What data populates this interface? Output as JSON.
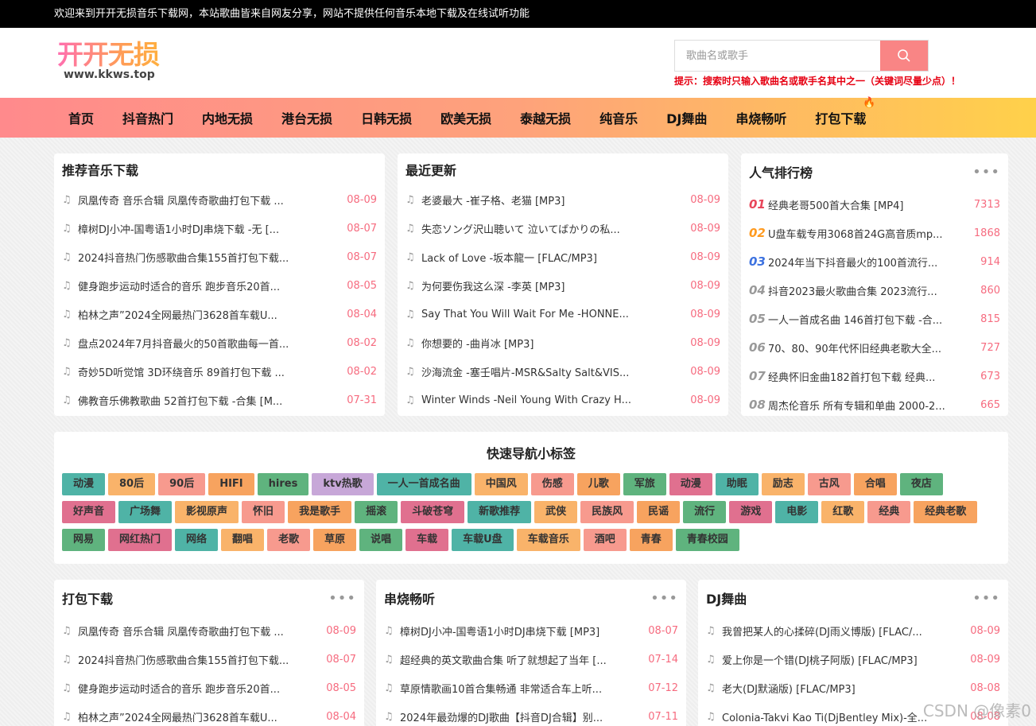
{
  "topbar": {
    "text": "欢迎来到开开无损音乐下载网，本站歌曲皆来自网友分享，网站不提供任何音乐本地下载及在线试听功能"
  },
  "logo": {
    "cn": "开开无损",
    "url": "www.kkws.top"
  },
  "search": {
    "placeholder": "歌曲名或歌手",
    "tip": "提示：搜索时只输入歌曲名或歌手名其中之一（关键词尽量少点）！"
  },
  "nav": [
    {
      "label": "首页"
    },
    {
      "label": "抖音热门"
    },
    {
      "label": "内地无损"
    },
    {
      "label": "港台无损"
    },
    {
      "label": "日韩无损"
    },
    {
      "label": "欧美无损"
    },
    {
      "label": "泰越无损"
    },
    {
      "label": "纯音乐"
    },
    {
      "label": "DJ舞曲"
    },
    {
      "label": "串烧畅听"
    },
    {
      "label": "打包下载"
    }
  ],
  "recommend": {
    "title": "推荐音乐下载",
    "items": [
      {
        "text": "凤凰传奇 音乐合辑 凤凰传奇歌曲打包下载 ...",
        "date": "08-09"
      },
      {
        "text": "樟树DJ小冲-国粤语1小时DJ串烧下载 -无 [...",
        "date": "08-07"
      },
      {
        "text": "2024抖音热门伤感歌曲合集155首打包下载...",
        "date": "08-07"
      },
      {
        "text": "健身跑步运动时适合的音乐 跑步音乐20首...",
        "date": "08-05"
      },
      {
        "text": "柏林之声”2024全网最热门3628首车载U...",
        "date": "08-04"
      },
      {
        "text": "盘点2024年7月抖音最火的50首歌曲每一首...",
        "date": "08-02"
      },
      {
        "text": "奇妙5D听觉馆 3D环绕音乐 89首打包下载 ...",
        "date": "08-02"
      },
      {
        "text": "佛教音乐佛教歌曲 52首打包下载 -合集 [M...",
        "date": "07-31"
      }
    ]
  },
  "latest": {
    "title": "最近更新",
    "items": [
      {
        "text": "老婆最大 -崔子格、老猫 [MP3]",
        "date": "08-09"
      },
      {
        "text": "失恋ソング沢山聴いて 泣いてばかりの私...",
        "date": "08-09"
      },
      {
        "text": "Lack of Love -坂本龍一 [FLAC/MP3]",
        "date": "08-09"
      },
      {
        "text": "为何要伤我这么深 -李英 [MP3]",
        "date": "08-09"
      },
      {
        "text": "Say That You Will Wait For Me -HONNE...",
        "date": "08-09"
      },
      {
        "text": "你想要的 -曲肖冰 [MP3]",
        "date": "08-09"
      },
      {
        "text": "沙海流金 -塞壬唱片-MSR&Salty Salt&VIS...",
        "date": "08-09"
      },
      {
        "text": "Winter Winds -Neil Young With Crazy H...",
        "date": "08-09"
      }
    ]
  },
  "ranking": {
    "title": "人气排行榜",
    "more": "•••",
    "items": [
      {
        "num": "01",
        "text": "经典老哥500首大合集 [MP4]",
        "count": "7313",
        "color": "#e8465a"
      },
      {
        "num": "02",
        "text": "U盘车载专用3068首24G高音质mp...",
        "count": "1868",
        "color": "#ff9a1f"
      },
      {
        "num": "03",
        "text": "2024年当下抖音最火的100首流行...",
        "count": "914",
        "color": "#3d72e0"
      },
      {
        "num": "04",
        "text": "抖音2023最火歌曲合集 2023流行...",
        "count": "860",
        "color": "#999999"
      },
      {
        "num": "05",
        "text": "一人一首成名曲 146首打包下载 -合...",
        "count": "815",
        "color": "#999999"
      },
      {
        "num": "06",
        "text": "70、80、90年代怀旧经典老歌大全...",
        "count": "727",
        "color": "#999999"
      },
      {
        "num": "07",
        "text": "经典怀旧金曲182首打包下载 经典...",
        "count": "673",
        "color": "#999999"
      },
      {
        "num": "08",
        "text": "周杰伦音乐 所有专辑和单曲 2000-2...",
        "count": "665",
        "color": "#999999"
      }
    ]
  },
  "tags": {
    "title": "快速导航小标签",
    "items": [
      {
        "label": "动漫",
        "color": "#4fb3a6"
      },
      {
        "label": "80后",
        "color": "#f9b36a"
      },
      {
        "label": "90后",
        "color": "#f79a8e"
      },
      {
        "label": "HIFI",
        "color": "#f7a35f"
      },
      {
        "label": "hires",
        "color": "#5fb37e"
      },
      {
        "label": "ktv热歌",
        "color": "#c7a7d8"
      },
      {
        "label": "一人一首成名曲",
        "color": "#4fb3a6"
      },
      {
        "label": "中国风",
        "color": "#f9b36a"
      },
      {
        "label": "伤感",
        "color": "#f79a8e"
      },
      {
        "label": "儿歌",
        "color": "#f7a35f"
      },
      {
        "label": "军旅",
        "color": "#5fb37e"
      },
      {
        "label": "动漫",
        "color": "#e0708f"
      },
      {
        "label": "助眠",
        "color": "#4fb3a6"
      },
      {
        "label": "励志",
        "color": "#f9b36a"
      },
      {
        "label": "古风",
        "color": "#f79a8e"
      },
      {
        "label": "合唱",
        "color": "#f7a35f"
      },
      {
        "label": "夜店",
        "color": "#5fb37e"
      },
      {
        "label": "好声音",
        "color": "#e0708f"
      },
      {
        "label": "广场舞",
        "color": "#4fb3a6"
      },
      {
        "label": "影视原声",
        "color": "#f9b36a"
      },
      {
        "label": "怀旧",
        "color": "#f79a8e"
      },
      {
        "label": "我是歌手",
        "color": "#f7a35f"
      },
      {
        "label": "摇滚",
        "color": "#5fb37e"
      },
      {
        "label": "斗破苍穹",
        "color": "#e0708f"
      },
      {
        "label": "新歌推荐",
        "color": "#4fb3a6"
      },
      {
        "label": "武侠",
        "color": "#f9b36a"
      },
      {
        "label": "民族风",
        "color": "#f79a8e"
      },
      {
        "label": "民谣",
        "color": "#f7a35f"
      },
      {
        "label": "流行",
        "color": "#5fb37e"
      },
      {
        "label": "游戏",
        "color": "#e0708f"
      },
      {
        "label": "电影",
        "color": "#4fb3a6"
      },
      {
        "label": "红歌",
        "color": "#f9b36a"
      },
      {
        "label": "经典",
        "color": "#f79a8e"
      },
      {
        "label": "经典老歌",
        "color": "#f7a35f"
      },
      {
        "label": "网易",
        "color": "#5fb37e"
      },
      {
        "label": "网红热门",
        "color": "#e0708f"
      },
      {
        "label": "网络",
        "color": "#4fb3a6"
      },
      {
        "label": "翻唱",
        "color": "#f9b36a"
      },
      {
        "label": "老歌",
        "color": "#f79a8e"
      },
      {
        "label": "草原",
        "color": "#f7a35f"
      },
      {
        "label": "说唱",
        "color": "#5fb37e"
      },
      {
        "label": "车载",
        "color": "#e0708f"
      },
      {
        "label": "车载U盘",
        "color": "#4fb3a6"
      },
      {
        "label": "车载音乐",
        "color": "#f9b36a"
      },
      {
        "label": "酒吧",
        "color": "#f79a8e"
      },
      {
        "label": "青春",
        "color": "#f7a35f"
      },
      {
        "label": "青春校园",
        "color": "#5fb37e"
      }
    ]
  },
  "packs": {
    "title": "打包下载",
    "more": "•••",
    "items": [
      {
        "text": "凤凰传奇 音乐合辑 凤凰传奇歌曲打包下载 ...",
        "date": "08-09"
      },
      {
        "text": "2024抖音热门伤感歌曲合集155首打包下载...",
        "date": "08-07"
      },
      {
        "text": "健身跑步运动时适合的音乐 跑步音乐20首...",
        "date": "08-05"
      },
      {
        "text": "柏林之声”2024全网最热门3628首车载U...",
        "date": "08-04"
      }
    ]
  },
  "medley": {
    "title": "串烧畅听",
    "more": "•••",
    "items": [
      {
        "text": "樟树DJ小冲-国粤语1小时DJ串烧下载 [MP3]",
        "date": "08-07"
      },
      {
        "text": "超经典的英文歌曲合集 听了就想起了当年 [...",
        "date": "07-14"
      },
      {
        "text": "草原情歌画10首合集畅通 非常适合车上听...",
        "date": "07-12"
      },
      {
        "text": "2024年最劲爆的DJ歌曲【抖音DJ合辑】别...",
        "date": "07-11"
      }
    ]
  },
  "dj": {
    "title": "DJ舞曲",
    "more": "•••",
    "items": [
      {
        "text": "我曾把某人的心揉碎(DJ雨义博版) [FLAC/...",
        "date": "08-09"
      },
      {
        "text": "爱上你是一个错(DJ桃子阿版) [FLAC/MP3]",
        "date": "08-09"
      },
      {
        "text": "老大(DJ默涵版) [FLAC/MP3]",
        "date": "08-08"
      },
      {
        "text": "Colonia-Takvi Kao Ti(DjBentley Mix)-全...",
        "date": "08-08"
      }
    ]
  },
  "watermark": "CSDN @像素0"
}
